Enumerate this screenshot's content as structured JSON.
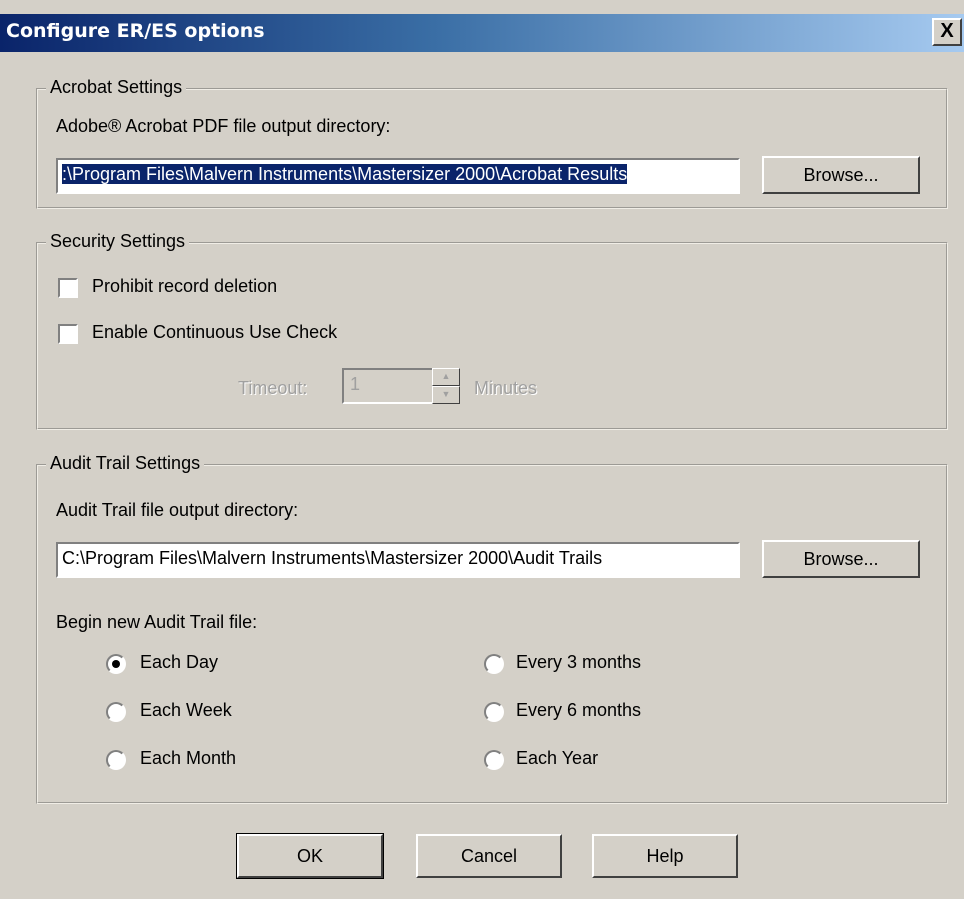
{
  "window": {
    "title": "Configure ER/ES options",
    "close_glyph": "X"
  },
  "acrobat": {
    "legend": "Acrobat Settings",
    "dir_label": "Adobe® Acrobat PDF file output directory:",
    "dir_value": ":\\Program Files\\Malvern Instruments\\Mastersizer 2000\\Acrobat Results",
    "browse_label": "Browse..."
  },
  "security": {
    "legend": "Security Settings",
    "prohibit_label": "Prohibit record deletion",
    "prohibit_checked": false,
    "continuous_label": "Enable Continuous Use Check",
    "continuous_checked": false,
    "timeout_label": "Timeout:",
    "timeout_value": "1",
    "minutes_label": "Minutes"
  },
  "audit": {
    "legend": "Audit Trail Settings",
    "dir_label": "Audit Trail file output directory:",
    "dir_value": "C:\\Program Files\\Malvern Instruments\\Mastersizer 2000\\Audit Trails",
    "browse_label": "Browse...",
    "begin_label": "Begin new Audit Trail file:",
    "options": [
      {
        "label": "Each Day",
        "checked": true
      },
      {
        "label": "Each Week",
        "checked": false
      },
      {
        "label": "Each Month",
        "checked": false
      },
      {
        "label": "Every 3 months",
        "checked": false
      },
      {
        "label": "Every 6 months",
        "checked": false
      },
      {
        "label": "Each Year",
        "checked": false
      }
    ]
  },
  "buttons": {
    "ok": "OK",
    "cancel": "Cancel",
    "help": "Help"
  }
}
